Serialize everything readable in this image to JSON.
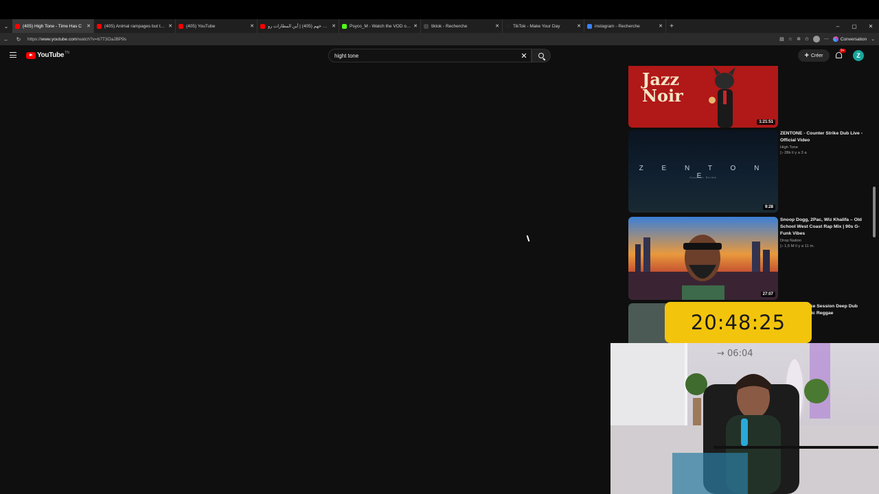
{
  "browser": {
    "tabs": [
      {
        "label": "(405) High Tone - Time Has C",
        "active": true,
        "favicon_color": "#ff0000"
      },
      {
        "label": "(405) Animal rampages but they g",
        "active": false,
        "favicon_color": "#ff0000"
      },
      {
        "label": "(405) YouTube",
        "active": false,
        "favicon_color": "#ff0000"
      },
      {
        "label": "شوب خهم (405) | أين المطارات رو",
        "active": false,
        "favicon_color": "#ff0000"
      },
      {
        "label": "Psyco_M - Watch the VOD on Kick",
        "active": false,
        "favicon_color": "#53fc18"
      },
      {
        "label": "tiktok - Recherche",
        "active": false,
        "favicon_color": "#444444"
      },
      {
        "label": "TikTok - Make Your Day",
        "active": false,
        "favicon_color": "#222222"
      },
      {
        "label": "instagram - Recherche",
        "active": false,
        "favicon_color": "#3b82f6"
      }
    ],
    "url_prefix": "https://",
    "url_host": "www.youtube.com",
    "url_path": "/watch?v=b7T3OaJBP9s",
    "conversation_label": "Conversation"
  },
  "youtube": {
    "logo_text": "YouTube",
    "logo_sup": "TN",
    "search_value": "hight tone",
    "create_label": "Créer",
    "notif_badge": "9+",
    "avatar_letter": "Z"
  },
  "recommendations": [
    {
      "title": "",
      "channel": "",
      "meta": "",
      "duration": "1:21:51",
      "thumb_text": "Jazz\nNoir"
    },
    {
      "title": "ZENTONE - Counter Strike Dub Live - Official Video",
      "channel": "High Tone",
      "meta": "▷ 28k  il y a 3 a",
      "duration": "9:28",
      "thumb_text": "Z E N T O N E",
      "thumb_sub": "Counter Strike"
    },
    {
      "title": "Snoop Dogg, 2Pac, Wiz Khalifa – Old School West Coast Rap Mix | 90s G-Funk Vibes",
      "channel": "Drop Nation",
      "meta": "▷ 1,5 M  il y a 11 m.",
      "duration": "27:07"
    },
    {
      "title": "...oke Session Deep Dub ...elic Reggae",
      "channel": "",
      "meta": "",
      "duration": ""
    }
  ],
  "overlay": {
    "clock": "20:48:25",
    "cam_timer": "→ 06:04"
  }
}
